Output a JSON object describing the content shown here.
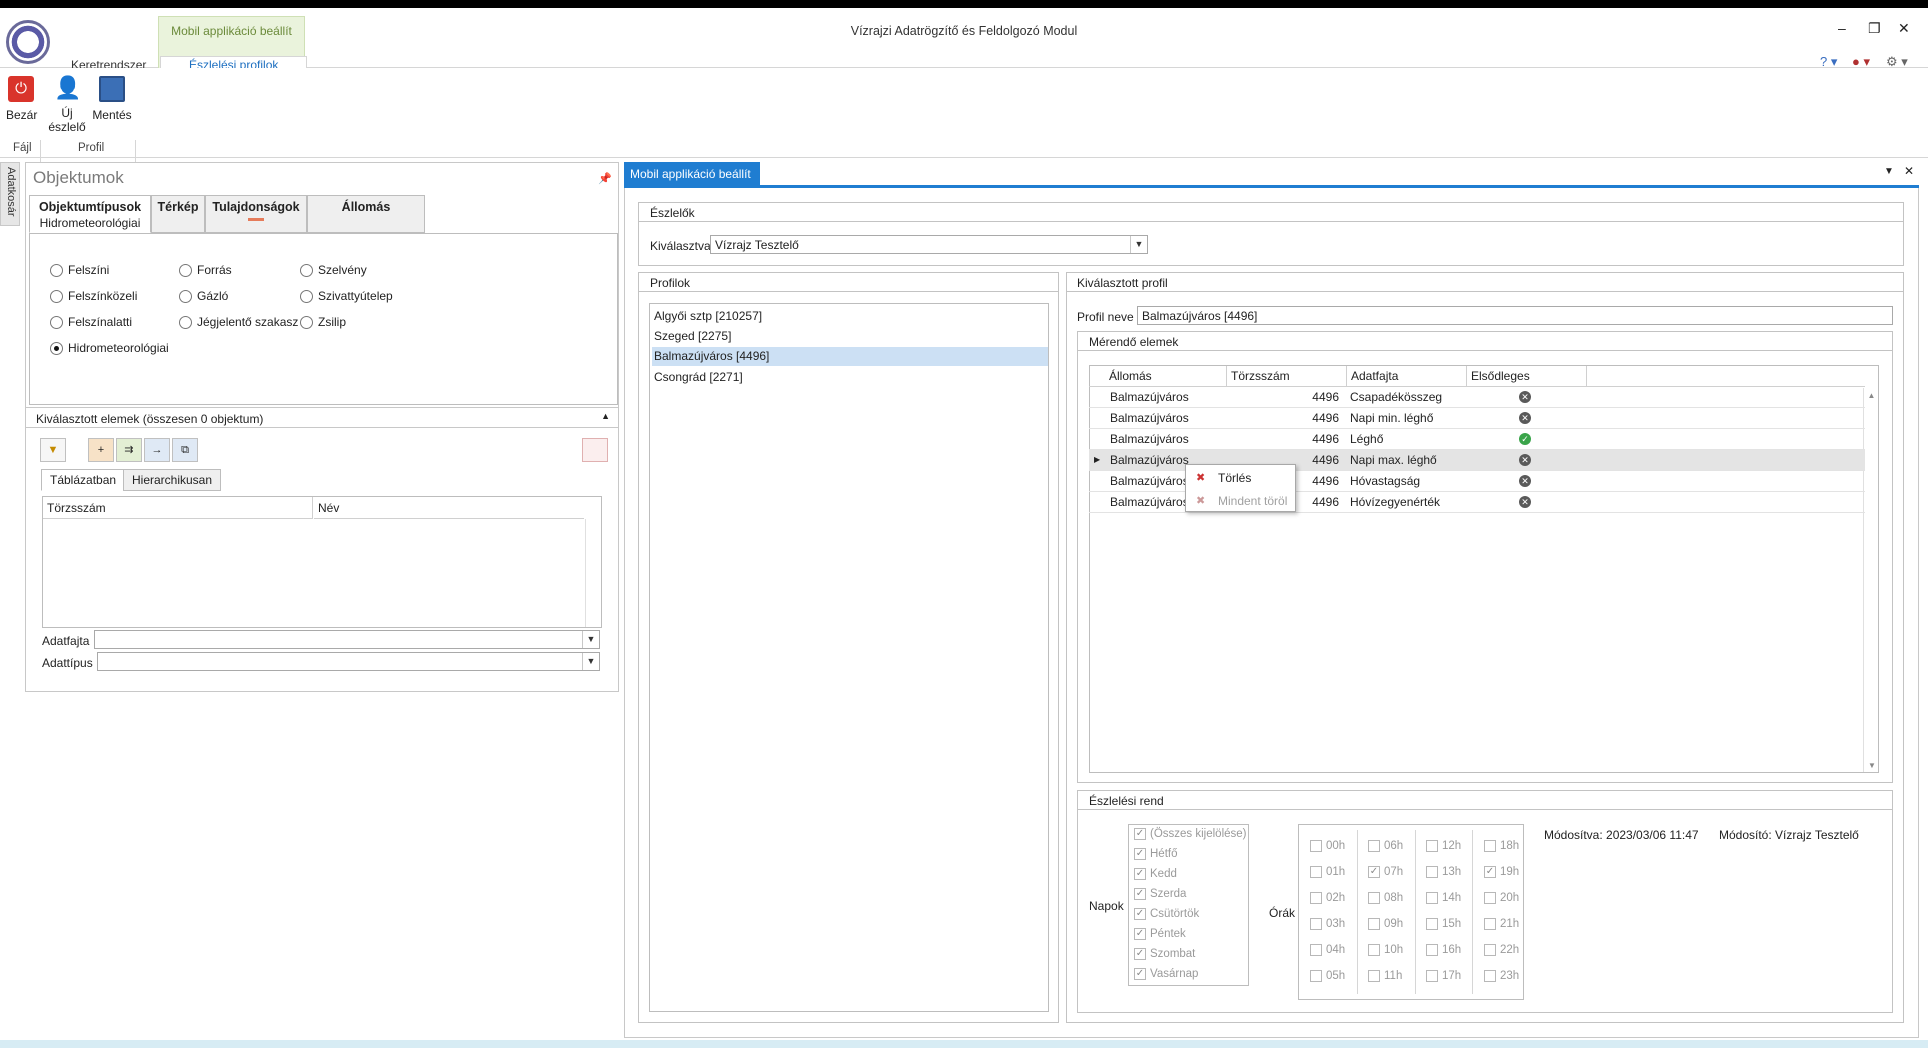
{
  "app": {
    "title": "Vízrajzi Adatrögzítő és Feldolgozó Modul",
    "context_group": "Mobil applikáció beállít",
    "tabs": [
      "Keretrendszer",
      "Észlelési profilok"
    ],
    "window_controls": {
      "minimize": "–",
      "restore": "❐",
      "close": "✕"
    }
  },
  "ribbon": {
    "buttons": {
      "close": "Bezár",
      "new_observer_1": "Új",
      "new_observer_2": "észlelő",
      "save": "Mentés"
    },
    "groups": {
      "file": "Fájl",
      "profile": "Profil"
    }
  },
  "sidebar_strip": "Adatkosár",
  "left_panel": {
    "title": "Objektumok",
    "tabs": [
      {
        "label": "Objektumtípusok",
        "sub": "Hidrometeorológiai"
      },
      {
        "label": "Térkép"
      },
      {
        "label": "Tulajdonságok"
      },
      {
        "label": "Állomás"
      }
    ],
    "radios": [
      "Felszíni",
      "Forrás",
      "Szelvény",
      "Felszínközeli",
      "Gázló",
      "Szivattyútelep",
      "Felszínalatti",
      "Jégjelentő szakasz",
      "Zsilip",
      "Hidrometeorológiai"
    ],
    "selected_header": "Kiválasztott elemek (összesen 0 objektum)",
    "subtabs": [
      "Táblázatban",
      "Hierarchikusan"
    ],
    "grid_cols": [
      "Törzsszám",
      "Név"
    ],
    "fields": {
      "data_kind": "Adatfajta",
      "data_type": "Adattípus"
    }
  },
  "doc": {
    "tab": "Mobil applikáció beállít",
    "observers": {
      "title": "Észlelők",
      "label": "Kiválasztva",
      "value": "Vízrajz Tesztelő"
    },
    "profiles": {
      "title": "Profilok",
      "items": [
        "Algyői sztp [210257]",
        "Szeged  [2275]",
        "Balmazújváros  [4496]",
        "Csongrád [2271]"
      ]
    },
    "selected_profile": {
      "title": "Kiválasztott profil",
      "name_label": "Profil neve",
      "name_value": "Balmazújváros  [4496]",
      "measured": {
        "title": "Mérendő elemek",
        "cols": [
          "Állomás",
          "Törzsszám",
          "Adatfajta",
          "Elsődleges"
        ],
        "rows": [
          {
            "station": "Balmazújváros",
            "id": "4496",
            "kind": "Csapadékösszeg",
            "primary": false
          },
          {
            "station": "Balmazújváros",
            "id": "4496",
            "kind": "Napi min. léghő",
            "primary": false
          },
          {
            "station": "Balmazújváros",
            "id": "4496",
            "kind": "Léghő",
            "primary": true
          },
          {
            "station": "Balmazújváros",
            "id": "4496",
            "kind": "Napi max. léghő",
            "primary": false
          },
          {
            "station": "Balmazújváros",
            "id": "4496",
            "kind": "Hóvastagság",
            "primary": false
          },
          {
            "station": "Balmazújváros",
            "id": "4496",
            "kind": "Hóvízegyenérték",
            "primary": false
          }
        ]
      },
      "context_menu": [
        "Törlés",
        "Mindent töröl"
      ],
      "schedule": {
        "title": "Észlelési rend",
        "days_label": "Napok",
        "days": [
          "(Összes kijelölése)",
          "Hétfő",
          "Kedd",
          "Szerda",
          "Csütörtök",
          "Péntek",
          "Szombat",
          "Vasárnap"
        ],
        "hours_label": "Órák",
        "hours": [
          "00h",
          "01h",
          "02h",
          "03h",
          "04h",
          "05h",
          "06h",
          "07h",
          "08h",
          "09h",
          "10h",
          "11h",
          "12h",
          "13h",
          "14h",
          "15h",
          "16h",
          "17h",
          "18h",
          "19h",
          "20h",
          "21h",
          "22h",
          "23h"
        ],
        "checked_hours": [
          "07h",
          "19h"
        ],
        "modified": "Módosítva: 2023/03/06 11:47",
        "modifier": "Módosító: Vízrajz Tesztelő"
      }
    }
  }
}
